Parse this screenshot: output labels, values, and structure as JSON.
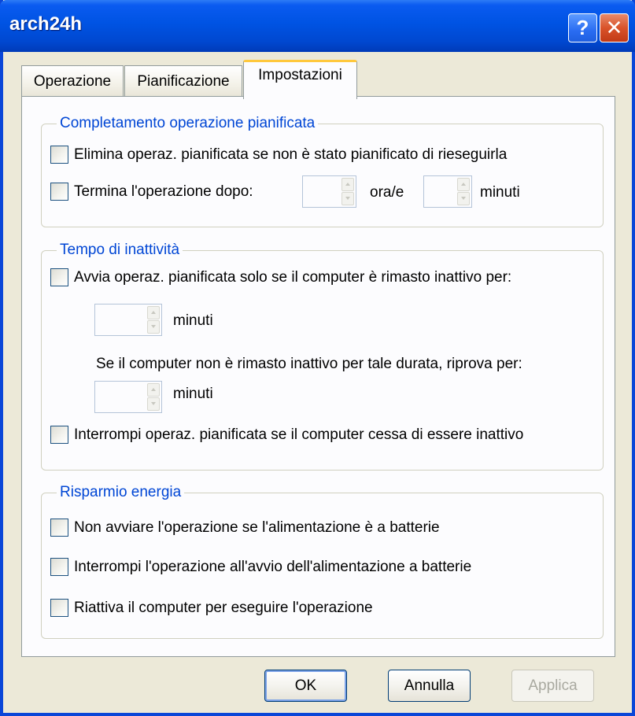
{
  "window": {
    "title": "arch24h",
    "help_glyph": "?",
    "close_glyph": "✕"
  },
  "tabs": [
    {
      "label": "Operazione"
    },
    {
      "label": "Pianificazione"
    },
    {
      "label": "Impostazioni",
      "selected": true
    }
  ],
  "groups": {
    "completamento": {
      "title": "Completamento operazione pianificata",
      "elimina_label": "Elimina operaz. pianificata se non è stato pianificato di rieseguirla",
      "termina_label": "Termina l'operazione dopo:",
      "ore_label": "ora/e",
      "minuti_label": "minuti",
      "ore_value": "",
      "minuti_value": ""
    },
    "inattivita": {
      "title": "Tempo di inattività",
      "avvia_label": "Avvia operaz. pianificata solo se il computer è rimasto inattivo per:",
      "minuti1_label": "minuti",
      "minuti1_value": "",
      "riprova_text": "Se il computer non è rimasto inattivo per tale durata, riprova per:",
      "minuti2_label": "minuti",
      "minuti2_value": "",
      "interrompi_label": "Interrompi operaz. pianificata se il computer cessa di essere inattivo"
    },
    "risparmio": {
      "title": "Risparmio energia",
      "non_avviare_label": "Non avviare l'operazione se l'alimentazione è a batterie",
      "interrompi_label": "Interrompi l'operazione all'avvio dell'alimentazione a batterie",
      "riattiva_label": "Riattiva il computer per eseguire l'operazione"
    }
  },
  "buttons": {
    "ok": "OK",
    "annulla": "Annulla",
    "applica": "Applica"
  },
  "colors": {
    "titlebar": "#0053e3",
    "group_title": "#0046d5",
    "selected_tab_accent": "#ffc83c"
  }
}
